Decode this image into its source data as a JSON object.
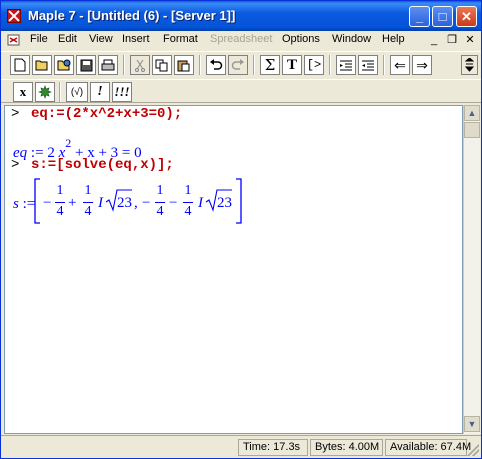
{
  "window": {
    "title": "Maple 7  - [Untitled (6) - [Server 1]]",
    "caption_minimize": "_",
    "caption_maximize": "□",
    "caption_close": "✕"
  },
  "menu": {
    "items": [
      "File",
      "Edit",
      "View",
      "Insert",
      "Format",
      "Spreadsheet",
      "Options",
      "Window",
      "Help"
    ],
    "disabled": [
      "Spreadsheet"
    ],
    "mdi_minimize": "_",
    "mdi_restore": "❐",
    "mdi_close": "✕"
  },
  "toolbar": {
    "sigma": "Σ",
    "text": "T",
    "prompt": "[>",
    "back": "⇐",
    "forward": "⇒"
  },
  "context_bar": {
    "x": "x",
    "check": "(√)",
    "bang": "!",
    "bangs": "!!!"
  },
  "worksheet": {
    "prompt_char": ">",
    "input1": "eq:=(2*x^2+x+3=0);",
    "output1": {
      "label": "eq",
      "assign": ":=",
      "coef": "2",
      "var": "x",
      "exp": "2",
      "rest": "+ x + 3 = 0"
    },
    "input2": "s:=[solve(eq,x)];",
    "output2": {
      "label": "s",
      "assign": ":=",
      "num": "1",
      "den": "4",
      "imag": "I",
      "radicand": "23"
    }
  },
  "status": {
    "time": "Time:  17.3s",
    "bytes": "Bytes:  4.00M",
    "available": "Available:  67.4M"
  },
  "colors": {
    "titlebar": "#0453d8",
    "input_text": "#c00000",
    "output_text": "#0000ff"
  }
}
